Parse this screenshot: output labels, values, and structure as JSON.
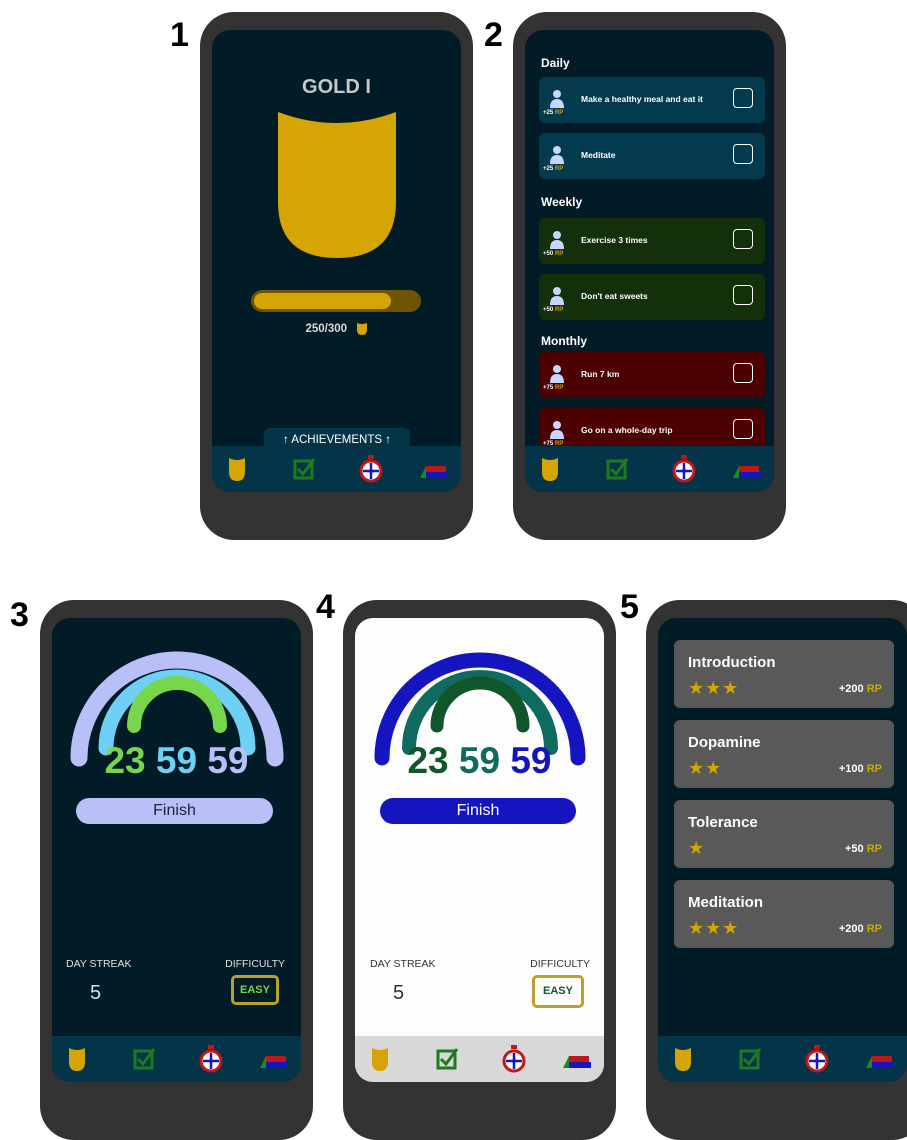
{
  "labels": [
    "1",
    "2",
    "3",
    "4",
    "5"
  ],
  "colors": {
    "gold": "#d4a504",
    "dark_screen": "#011c26",
    "nav": "#033447",
    "daily": "#043a4d",
    "weekly": "#14300a",
    "monthly": "#4d0000"
  },
  "screen1": {
    "rank": "GOLD I",
    "progress_text": "250/300",
    "progress_current": 250,
    "progress_max": 300,
    "achievements_tab": "↑ ACHIEVEMENTS ↑"
  },
  "screen2": {
    "sections": [
      "Daily",
      "Weekly",
      "Monthly"
    ],
    "rp_unit": "RP",
    "tasks": [
      {
        "label": "Make a healthy meal and eat it",
        "points": "+25"
      },
      {
        "label": "Meditate",
        "points": "+25"
      },
      {
        "label": "Exercise 3 times",
        "points": "+50"
      },
      {
        "label": "Don't eat sweets",
        "points": "+50"
      },
      {
        "label": "Run 7 km",
        "points": "+75"
      },
      {
        "label": "Go on a whole-day trip",
        "points": "+75"
      }
    ]
  },
  "timer": {
    "hours": "23",
    "minutes": "59",
    "seconds": "59"
  },
  "finish_label": "Finish",
  "day_streak_label": "DAY STREAK",
  "difficulty_label": "DIFFICULTY",
  "day_streak_value": "5",
  "difficulty_value": "EASY",
  "screen5": {
    "rp_unit": "RP",
    "achievements": [
      {
        "title": "Introduction",
        "stars": "★★★",
        "points": "+200"
      },
      {
        "title": "Dopamine",
        "stars": "★★",
        "points": "+100"
      },
      {
        "title": "Tolerance",
        "stars": "★",
        "points": "+50"
      },
      {
        "title": "Meditation",
        "stars": "★★★",
        "points": "+200"
      }
    ]
  },
  "nav_icons": [
    "rank-shield-icon",
    "checkbox-icon",
    "stopwatch-icon",
    "books-icon"
  ]
}
